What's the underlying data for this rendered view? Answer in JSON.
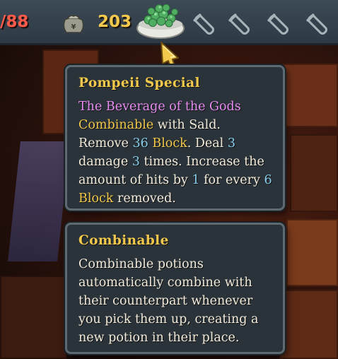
{
  "topbar": {
    "hp_text": "/88",
    "gold_amount": "203",
    "icons": [
      "money-bag-icon",
      "potion-bowl-icon",
      "empty-potion-slot-icon"
    ],
    "empty_slot_count": 4
  },
  "tooltip_potion": {
    "title": "Pompeii Special",
    "lines": [
      [
        {
          "text": "The Beverage of the Gods",
          "color": "purple"
        }
      ],
      [
        {
          "text": "Combinable",
          "color": "gold"
        },
        {
          "text": " with Sald.",
          "color": "white"
        }
      ],
      [
        {
          "text": "Remove ",
          "color": "white"
        },
        {
          "text": "36",
          "color": "blue"
        },
        {
          "text": " ",
          "color": "white"
        },
        {
          "text": "Block",
          "color": "gold"
        },
        {
          "text": ". Deal ",
          "color": "white"
        },
        {
          "text": "3",
          "color": "blue"
        }
      ],
      [
        {
          "text": "damage ",
          "color": "white"
        },
        {
          "text": "3",
          "color": "blue"
        },
        {
          "text": " times. Increase the",
          "color": "white"
        }
      ],
      [
        {
          "text": "amount of hits by ",
          "color": "white"
        },
        {
          "text": "1",
          "color": "blue"
        },
        {
          "text": " for every ",
          "color": "white"
        },
        {
          "text": "6",
          "color": "blue"
        }
      ],
      [
        {
          "text": "Block",
          "color": "gold"
        },
        {
          "text": " removed.",
          "color": "white"
        }
      ]
    ]
  },
  "tooltip_keyword": {
    "title": "Combinable",
    "lines": [
      "Combinable potions",
      "automatically combine with",
      "their counterpart whenever",
      "you pick them up, creating a",
      "new potion in their place."
    ]
  },
  "colors": {
    "gold": "#f2c94c",
    "purple": "#e68cf0",
    "blue": "#87ceeb",
    "text": "#f3ecdd",
    "hp": "#ff5a4a"
  }
}
